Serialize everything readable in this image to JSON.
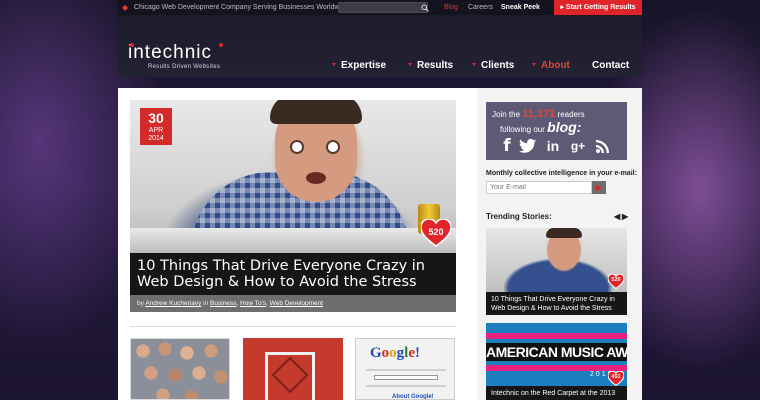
{
  "topbar": {
    "tagline": "Chicago Web Development Company Serving Businesses Worldwide",
    "search_icon": "magnifier-icon",
    "links": {
      "blog": "Blog",
      "careers": "Careers",
      "sneak_peek": "Sneak Peek"
    },
    "cta": "Start Getting Results"
  },
  "header": {
    "logo": "intechnic",
    "logo_tagline": "Results Driven Websites",
    "nav": {
      "expertise": "Expertise",
      "results": "Results",
      "clients": "Clients",
      "about": "About",
      "contact": "Contact"
    }
  },
  "featured": {
    "date": {
      "day": "30",
      "month": "APR",
      "year": "2014"
    },
    "likes": "520",
    "title": "10 Things That Drive Everyone Crazy in Web Design & How to Avoid the Stress",
    "meta_by": "by",
    "author": "Andrew Kucheriavy",
    "meta_in": "in",
    "categories": [
      "Business",
      "How To's",
      "Web Development"
    ]
  },
  "thumbs": {
    "google_word": [
      "G",
      "o",
      "o",
      "g",
      "l",
      "e",
      "!"
    ],
    "google_about": "About Google!"
  },
  "sidebar": {
    "join_prefix": "Join the",
    "join_count": "11,371",
    "join_suffix": "readers",
    "join_line2_prefix": "following our",
    "join_line2_word": "blog:",
    "social": {
      "facebook": "f",
      "twitter": "🐦",
      "linkedin": "in",
      "googleplus": "g+",
      "rss": "◉"
    },
    "newsletter_label": "Monthly collective intelligence in your e-mail:",
    "email_placeholder": "Your E-mail",
    "trending_label": "Trending Stories:",
    "stories": [
      {
        "title": "10 Things That Drive Everyone Crazy in Web Design & How to Avoid the Stress",
        "likes": "520"
      },
      {
        "title": "Intechnic on the Red Carpet at the 2013",
        "likes": "451",
        "image_text": "AMERICAN MUSIC AWARDS",
        "image_year": "2013"
      }
    ]
  },
  "colors": {
    "accent": "#e0242a",
    "header_bg": "#1c1b2a",
    "join_bg": "#5c5a74"
  }
}
